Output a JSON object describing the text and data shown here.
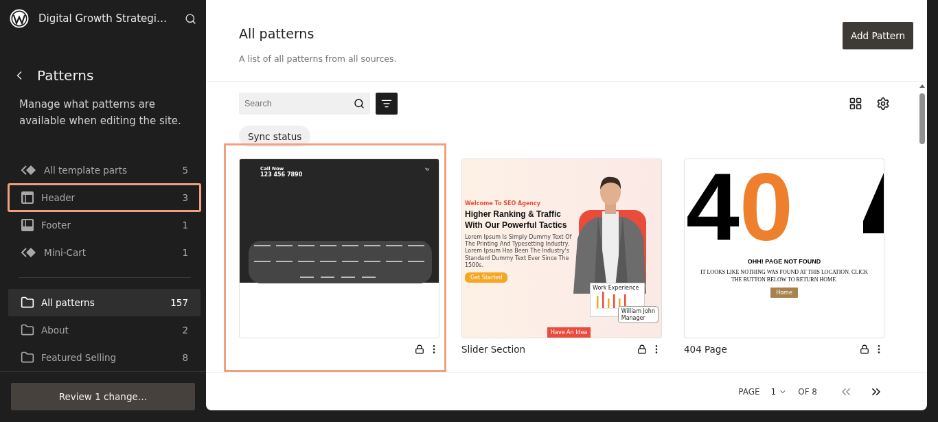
{
  "site": {
    "title": "Digital Growth Strategi…"
  },
  "sidebar": {
    "title": "Patterns",
    "description": "Manage what patterns are available when editing the site.",
    "template_parts": [
      {
        "kind": "symbol",
        "label": "All template parts",
        "count": "5",
        "focused": false
      },
      {
        "kind": "header",
        "label": "Header",
        "count": "3",
        "focused": true
      },
      {
        "kind": "footer",
        "label": "Footer",
        "count": "1",
        "focused": false
      },
      {
        "kind": "symbol",
        "label": "Mini-Cart",
        "count": "1",
        "focused": false
      }
    ],
    "categories": [
      {
        "label": "All patterns",
        "count": "157",
        "selected": true
      },
      {
        "label": "About",
        "count": "2",
        "selected": false
      },
      {
        "label": "Featured Selling",
        "count": "8",
        "selected": false
      }
    ],
    "review_button": "Review 1 change…"
  },
  "main": {
    "title": "All patterns",
    "description": "A list of all patterns from all sources.",
    "add_button": "Add Pattern",
    "search": {
      "placeholder": "Search"
    },
    "filter_chip": "Sync status",
    "patterns": [
      {
        "kind": "header",
        "selected": true,
        "texts": {
          "call": "Call Now",
          "phone": "123 456 7890"
        }
      },
      {
        "kind": "slider",
        "selected": false,
        "title": "Slider Section",
        "texts": {
          "eyebrow": "Welcome To SEO Agency",
          "heading": "Higher Ranking & Traffic With Our Powerful Tactics",
          "body": "Lorem Ipsum Is Simply Dummy Text Of The Printing And Typesetting Industry. Lorem Ipsum Has Been The Industry's Standard Dummy Text Ever Since The 1500s.",
          "button": "Get Started",
          "chart_title": "Work Experience",
          "name": "William John",
          "role": "Manager",
          "tab": "Have An Idea"
        }
      },
      {
        "kind": "notfound",
        "selected": false,
        "title": "404 Page",
        "texts": {
          "digits": "40",
          "heading": "OHH! PAGE NOT FOUND",
          "body": "IT LOOKS LIKE NOTHING WAS FOUND AT THIS LOCATION. CLICK THE BUTTON BELOW TO RETURN HOME.",
          "button": "Home"
        }
      }
    ],
    "pagination": {
      "page_label": "PAGE",
      "page": "1",
      "of_label": "OF 8",
      "previous_disabled": true,
      "next_disabled": false
    }
  }
}
